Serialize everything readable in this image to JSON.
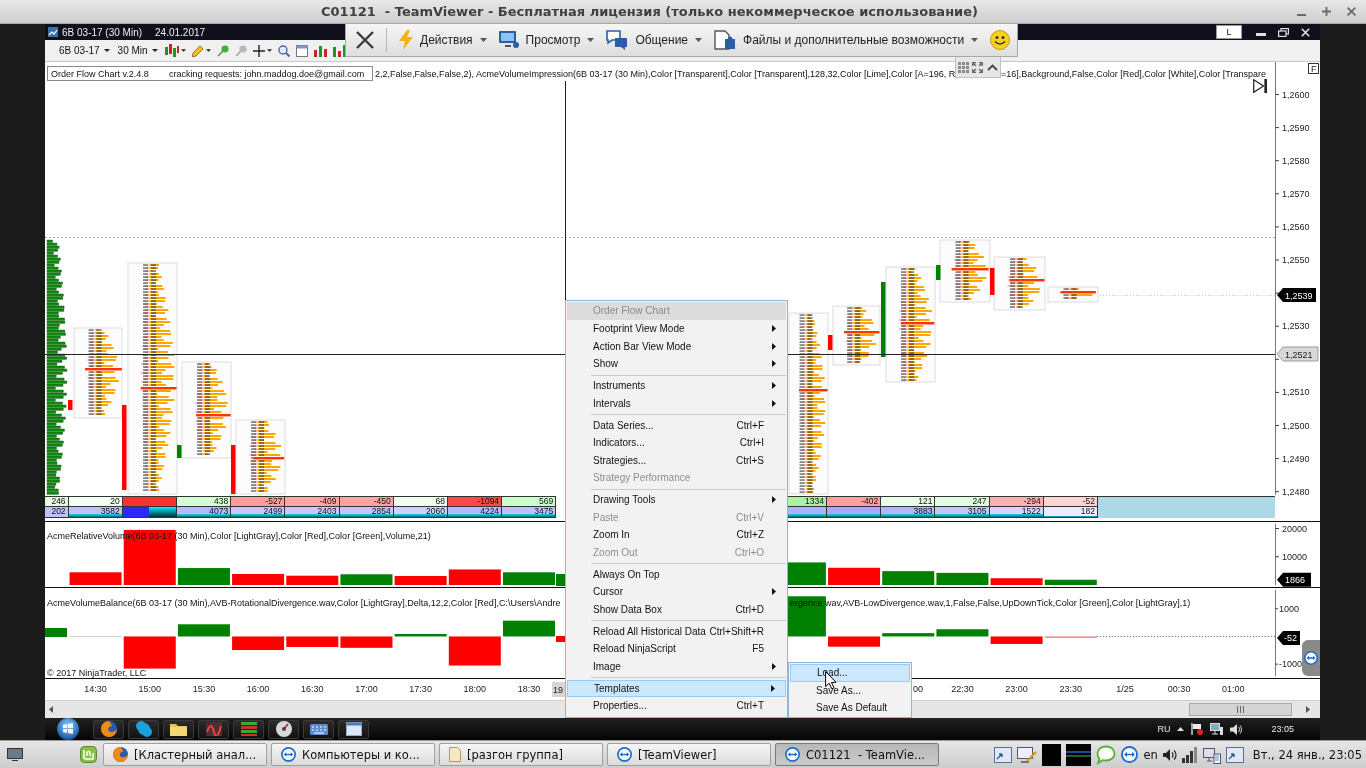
{
  "window": {
    "title": "C01121  - TeamViewer - Бесплатная лицензия (только некоммерческое использование)"
  },
  "remote_toolbar": {
    "menus": [
      {
        "label": "Действия"
      },
      {
        "label": "Просмотр"
      },
      {
        "label": "Общение"
      },
      {
        "label": "Файлы и дополнительные возможности"
      }
    ]
  },
  "chart_window": {
    "instrument_title": "6B 03-17 (30 Min)",
    "date": "24.01.2017",
    "layout_button": "L",
    "instrument": "6B 03-17",
    "interval": "30 Min",
    "float_button": "F"
  },
  "price_pane": {
    "info_title": "Order Flow Chart v.2.4.8",
    "info_note": "cracking requests: john.maddog.doe@gmail.com",
    "indicator_text": [
      "2,2,False,False,False,2), AcmeVolumeImpression(6B 03-17 (30 Min),Color [Transparent],Color [Transparent],128,32,Color [Lime],Color [A=196, R",
      "=16],Background,False,Color [Red],Color [White],Color [Transpare"
    ],
    "axis_labels": [
      [
        "1,2600",
        "1,2590",
        "1,2580",
        "1,2570",
        "1,2560",
        "1,2550"
      ],
      [
        "1,2530"
      ],
      [
        "1,2510",
        "1,2500",
        "1,2490",
        "1,2480"
      ]
    ],
    "last_price_tag": "1,2539",
    "crosshair_price_tag": "1,2521",
    "delta_cells_left": [
      {
        "text": "246",
        "color": "#e6f8e6"
      },
      {
        "text": "20",
        "color": "#f2fff2"
      },
      {
        "color": "#ff3030"
      },
      {
        "text": "438",
        "color": "#d4ffd4"
      },
      {
        "text": "-527",
        "color": "#ff9c9c"
      },
      {
        "text": "-409",
        "color": "#ffa6a6"
      },
      {
        "text": "-450",
        "color": "#ffa2a2"
      },
      {
        "text": "68",
        "color": "#effff0"
      },
      {
        "text": "-1094",
        "color": "#ff4848"
      },
      {
        "text": "569",
        "color": "#ccffcc"
      }
    ],
    "delta_cells_right": [
      {
        "text": "1334",
        "color": "#aef0a8"
      },
      {
        "text": "-402",
        "color": "#ffa0a0"
      },
      {
        "text": "121",
        "color": "#eaffea"
      },
      {
        "text": "247",
        "color": "#e0ffe0"
      },
      {
        "text": "-294",
        "color": "#ffb0b0"
      },
      {
        "text": "-52",
        "color": "#ffd4d4"
      }
    ],
    "volume_cells_left": [
      {
        "text": "202",
        "color": "#c0c0ff"
      },
      {
        "text": "3582",
        "color": "#c0c0ff"
      },
      {
        "color": "#2a2aff"
      },
      {
        "text": "4073",
        "color": "#b8b8ff"
      },
      {
        "text": "2499",
        "color": "#c8c8ff"
      },
      {
        "text": "2403",
        "color": "#c8c8ff"
      },
      {
        "text": "2854",
        "color": "#c4c4ff"
      },
      {
        "text": "2060",
        "color": "#d0d0ff"
      },
      {
        "text": "4224",
        "color": "#b8b8ff"
      },
      {
        "text": "3475",
        "color": "#c0c0ff"
      }
    ],
    "volume_cells_right": [
      {
        "color": "#b0b0ff"
      },
      {
        "color": "#a8a8ff"
      },
      {
        "text": "3883",
        "color": "#b4b4ff"
      },
      {
        "text": "3105",
        "color": "#c4c4ff"
      },
      {
        "text": "1522",
        "color": "#d4d4ff"
      },
      {
        "text": "182",
        "color": "#ececff"
      }
    ]
  },
  "relative_volume": {
    "label": "AcmeRelativeVolume(6B 03-17 (30 Min),Color [LightGray],Color [Red],Color [Green],Volume,21)",
    "last_value_tag": "1866",
    "chart_data": [
      {
        "type": "bar",
        "x": [
          "2017-01-24T14:30",
          "2017-01-24T15:00",
          "2017-01-24T15:30",
          "2017-01-24T16:00",
          "2017-01-24T16:30",
          "2017-01-24T17:00",
          "2017-01-24T17:30",
          "2017-01-24T18:00",
          "2017-01-24T18:30",
          "2017-01-24T21:00",
          "2017-01-24T21:30",
          "2017-01-24T22:00",
          "2017-01-24T22:30",
          "2017-01-24T23:00",
          "2017-01-24T23:30"
        ],
        "values": [
          4500,
          19500,
          6000,
          3900,
          3300,
          3800,
          3200,
          5500,
          4500,
          8000,
          6100,
          4900,
          4300,
          2400,
          1866
        ],
        "colors": [
          "#ff0000",
          "#ff0000",
          "#008000",
          "#ff0000",
          "#ff0000",
          "#008000",
          "#ff0000",
          "#ff0000",
          "#008000",
          "#008000",
          "#ff0000",
          "#008000",
          "#008000",
          "#ff0000",
          "#008000"
        ],
        "xlim": [
          "2017-01-24T14:02",
          "2017-01-25T01:48"
        ],
        "ylim": [
          -700,
          22300
        ],
        "yticks": [
          10000,
          20000
        ],
        "tick_labels": "y"
      }
    ]
  },
  "volume_balance": {
    "label": "AcmeVolumeBalance(6B 03-17 (30 Min),AVB-RotationalDivergence.wav,Color [LightGray],Delta,12,2,Color [Red],C:\\Users\\Andre",
    "label_continued": "ergence.wav,AVB-LowDivergence.wav,1,False,False,UpDownTick,Color [Green],Color [LightGray],1)",
    "last_value_tag": "-52",
    "copyright": "© 2017 NinjaTrader, LLC",
    "crosshair_time_tag": "19",
    "time_label_fragment": "00",
    "chart_data": [
      {
        "type": "bar",
        "x": [
          "2017-01-24T14:30",
          "2017-01-24T15:00",
          "2017-01-24T15:30",
          "2017-01-24T16:00",
          "2017-01-24T16:30",
          "2017-01-24T17:00",
          "2017-01-24T17:30",
          "2017-01-24T18:00",
          "2017-01-24T18:30",
          "2017-01-24T21:00",
          "2017-01-24T21:30",
          "2017-01-24T22:00",
          "2017-01-24T22:30",
          "2017-01-24T23:00",
          "2017-01-24T23:30"
        ],
        "values": [
          20,
          -1160,
          440,
          -490,
          -380,
          -410,
          90,
          -1050,
          570,
          1450,
          -370,
          120,
          260,
          -270,
          -52
        ],
        "colors": [
          "#d3d3d3",
          "#ff0000",
          "#008000",
          "#ff0000",
          "#ff0000",
          "#ff0000",
          "#008000",
          "#ff0000",
          "#008000",
          "#008000",
          "#ff0000",
          "#008000",
          "#008000",
          "#ff0000",
          "#f08080"
        ],
        "xlim": [
          "2017-01-24T14:02",
          "2017-01-25T01:48"
        ],
        "ylim": [
          -1500,
          1750
        ],
        "xticks": [
          {
            "value": "2017-01-24T14:30",
            "label": "14:30"
          },
          {
            "value": "2017-01-24T15:00",
            "label": "15:00"
          },
          {
            "value": "2017-01-24T15:30",
            "label": "15:30"
          },
          {
            "value": "2017-01-24T16:00",
            "label": "16:00"
          },
          {
            "value": "2017-01-24T16:30",
            "label": "16:30"
          },
          {
            "value": "2017-01-24T17:00",
            "label": "17:00"
          },
          {
            "value": "2017-01-24T17:30",
            "label": "17:30"
          },
          {
            "value": "2017-01-24T18:00",
            "label": "18:00"
          },
          {
            "value": "2017-01-24T18:30",
            "label": "18:30"
          },
          {
            "value": "2017-01-24T22:30",
            "label": "22:30"
          },
          {
            "value": "2017-01-24T23:00",
            "label": "23:00"
          },
          {
            "value": "2017-01-24T23:30",
            "label": "23:30"
          },
          {
            "value": "2017-01-25T00:00",
            "label": "1/25"
          },
          {
            "value": "2017-01-25T00:30",
            "label": "00:30"
          },
          {
            "value": "2017-01-25T01:00",
            "label": "01:00"
          }
        ],
        "yticks": [
          1000,
          -1000
        ]
      }
    ]
  },
  "context_menu": {
    "header": "Order Flow Chart",
    "groups": [
      [
        {
          "label": "Footprint View Mode",
          "submenu": true,
          "disabled": false,
          "selected": false
        },
        {
          "label": "Action Bar View Mode",
          "submenu": true,
          "disabled": false,
          "selected": false
        },
        {
          "label": "Show",
          "submenu": true,
          "disabled": false,
          "selected": false
        }
      ],
      [
        {
          "label": "Instruments",
          "submenu": true,
          "disabled": false,
          "selected": false
        },
        {
          "label": "Intervals",
          "submenu": true,
          "disabled": false,
          "selected": false
        }
      ],
      [
        {
          "label": "Data Series...",
          "shortcut": "Ctrl+F",
          "submenu": false,
          "disabled": false,
          "selected": false
        },
        {
          "label": "Indicators...",
          "shortcut": "Ctrl+I",
          "submenu": false,
          "disabled": false,
          "selected": false
        },
        {
          "label": "Strategies...",
          "shortcut": "Ctrl+S",
          "submenu": false,
          "disabled": false,
          "selected": false
        },
        {
          "label": "Strategy Performance",
          "submenu": false,
          "disabled": true,
          "selected": false
        }
      ],
      [
        {
          "label": "Drawing Tools",
          "submenu": true,
          "disabled": false,
          "selected": false
        },
        {
          "label": "Paste",
          "shortcut": "Ctrl+V",
          "submenu": false,
          "disabled": true,
          "selected": false
        },
        {
          "label": "Zoom In",
          "shortcut": "Ctrl+Z",
          "submenu": false,
          "disabled": false,
          "selected": false
        },
        {
          "label": "Zoom Out",
          "shortcut": "Ctrl+O",
          "submenu": false,
          "disabled": true,
          "selected": false
        }
      ],
      [
        {
          "label": "Always On Top",
          "submenu": false,
          "disabled": false,
          "selected": false
        },
        {
          "label": "Cursor",
          "submenu": true,
          "disabled": false,
          "selected": false
        },
        {
          "label": "Show Data Box",
          "shortcut": "Ctrl+D",
          "submenu": false,
          "disabled": false,
          "selected": false
        }
      ],
      [
        {
          "label": "Reload All Historical Data",
          "shortcut": "Ctrl+Shift+R",
          "submenu": false,
          "disabled": false,
          "selected": false
        },
        {
          "label": "Reload NinjaScript",
          "shortcut": "F5",
          "submenu": false,
          "disabled": false,
          "selected": false
        },
        {
          "label": "Image",
          "submenu": true,
          "disabled": false,
          "selected": false
        }
      ],
      [
        {
          "label": "Templates",
          "submenu": true,
          "disabled": false,
          "selected": true
        },
        {
          "label": "Properties...",
          "shortcut": "Ctrl+T",
          "submenu": false,
          "disabled": false,
          "selected": false
        }
      ]
    ]
  },
  "submenu": {
    "items": [
      {
        "label": "Load...",
        "selected": true
      },
      {
        "label": "Save As...",
        "selected": false
      },
      {
        "label": "Save As Default",
        "selected": false
      }
    ]
  },
  "remote_taskbar": {
    "language": "RU",
    "clock": "23:05"
  },
  "panel": {
    "tasks": [
      {
        "label": "[Кластерный анал...",
        "selected": false
      },
      {
        "label": "Компьютеры и ко...",
        "selected": false
      },
      {
        "label": "[разгон группа]",
        "selected": false
      },
      {
        "label": "[TeamViewer]",
        "selected": false
      },
      {
        "label": "C01121  - TeamVie...",
        "selected": true
      }
    ],
    "language": "en",
    "clock": "Вт., 24 янв., 23:05"
  }
}
